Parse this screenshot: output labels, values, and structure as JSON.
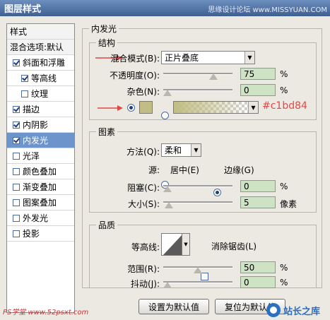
{
  "window": {
    "title": "图层样式",
    "watermark_top": "思缘设计论坛 www.MISSYUAN.COM"
  },
  "style_list": {
    "header": "样式",
    "blend_default": "混合选项:默认",
    "items": [
      {
        "label": "斜面和浮雕",
        "checked": true
      },
      {
        "label": "等高线",
        "checked": true
      },
      {
        "label": "纹理",
        "checked": false
      },
      {
        "label": "描边",
        "checked": true
      },
      {
        "label": "内阴影",
        "checked": true
      },
      {
        "label": "内发光",
        "checked": true,
        "selected": true
      },
      {
        "label": "光泽",
        "checked": false
      },
      {
        "label": "颜色叠加",
        "checked": false
      },
      {
        "label": "渐变叠加",
        "checked": false
      },
      {
        "label": "图案叠加",
        "checked": false
      },
      {
        "label": "外发光",
        "checked": false
      },
      {
        "label": "投影",
        "checked": false
      }
    ]
  },
  "inner_glow": {
    "title": "内发光",
    "structure": {
      "title": "结构",
      "blend_mode_label": "混合模式(B):",
      "blend_mode_value": "正片叠底",
      "opacity_label": "不透明度(O):",
      "opacity_value": "75",
      "opacity_pct": 0.75,
      "noise_label": "杂色(N):",
      "noise_value": "0",
      "noise_pct": 0.0,
      "percent": "%",
      "color_hex": "#c1bd84",
      "color_annotation": "#c1bd84"
    },
    "elements": {
      "title": "图素",
      "method_label": "方法(Q):",
      "method_value": "柔和",
      "source_label": "源:",
      "source_center": "居中(E)",
      "source_edge": "边缘(G)",
      "choke_label": "阻塞(C):",
      "choke_value": "0",
      "choke_pct": 0.0,
      "size_label": "大小(S):",
      "size_value": "5",
      "size_pct": 0.02,
      "size_unit": "像素",
      "percent": "%"
    },
    "quality": {
      "title": "品质",
      "contour_label": "等高线:",
      "anti_alias_label": "消除锯齿(L)",
      "range_label": "范围(R):",
      "range_value": "50",
      "range_pct": 0.5,
      "jitter_label": "抖动(J):",
      "jitter_value": "0",
      "jitter_pct": 0.0,
      "percent": "%"
    },
    "buttons": {
      "set_default": "设置为默认值",
      "reset_default": "复位为默认值"
    }
  },
  "watermarks": {
    "bottom_left": "PS学堂 www.52psxt.com",
    "bottom_right": "站长之库"
  },
  "colors": {
    "accent": "#6d95cc",
    "field_bg": "#cde3c4",
    "annotation": "#e04848"
  }
}
